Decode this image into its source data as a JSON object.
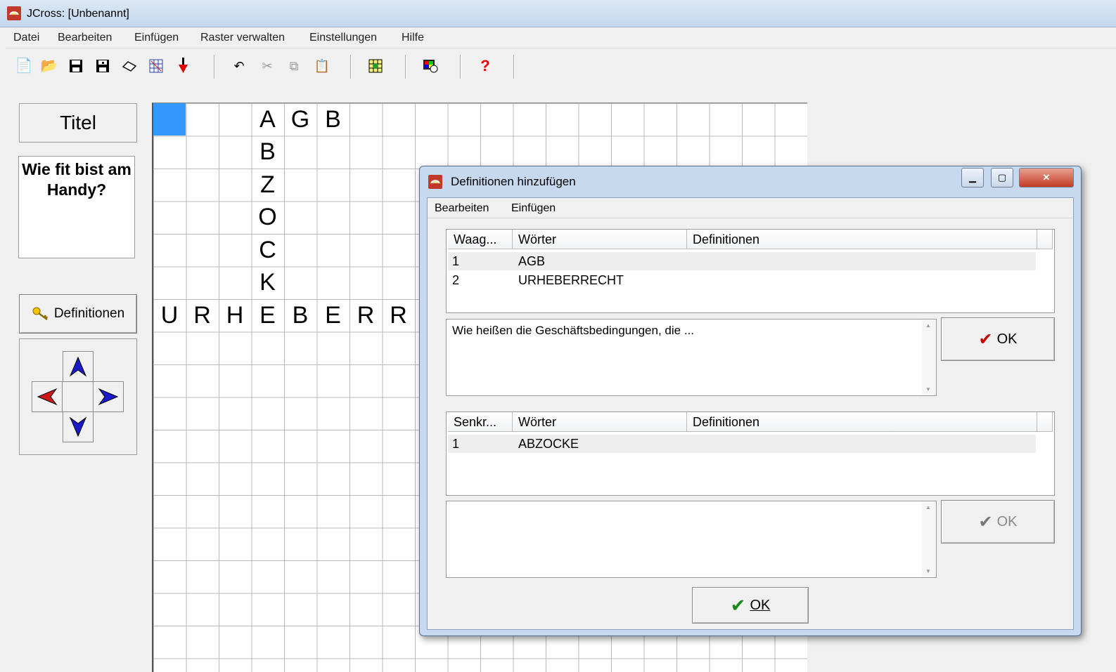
{
  "window": {
    "title": "JCross: [Unbenannt]"
  },
  "menu": [
    "Datei",
    "Bearbeiten",
    "Einfügen",
    "Raster verwalten",
    "Einstellungen",
    "Hilfe"
  ],
  "toolbar": {
    "icons": [
      "new-icon",
      "open-icon",
      "save-icon",
      "save-as-icon",
      "erase-icon",
      "grid-random-icon",
      "export-icon",
      "undo-icon",
      "cut-icon",
      "copy-icon",
      "paste-icon",
      "grid-add-icon",
      "web-icon",
      "help-icon"
    ]
  },
  "left": {
    "title_button": "Titel",
    "description": "Wie fit bist am Handy?",
    "definitions_button": "Definitionen"
  },
  "grid": {
    "cells": [
      {
        "r": 0,
        "c": 3,
        "ch": "A"
      },
      {
        "r": 0,
        "c": 4,
        "ch": "G"
      },
      {
        "r": 0,
        "c": 5,
        "ch": "B"
      },
      {
        "r": 1,
        "c": 3,
        "ch": "B"
      },
      {
        "r": 2,
        "c": 3,
        "ch": "Z"
      },
      {
        "r": 3,
        "c": 3,
        "ch": "O"
      },
      {
        "r": 4,
        "c": 3,
        "ch": "C"
      },
      {
        "r": 5,
        "c": 3,
        "ch": "K"
      },
      {
        "r": 6,
        "c": 0,
        "ch": "U"
      },
      {
        "r": 6,
        "c": 1,
        "ch": "R"
      },
      {
        "r": 6,
        "c": 2,
        "ch": "H"
      },
      {
        "r": 6,
        "c": 3,
        "ch": "E"
      },
      {
        "r": 6,
        "c": 4,
        "ch": "B"
      },
      {
        "r": 6,
        "c": 5,
        "ch": "E"
      },
      {
        "r": 6,
        "c": 6,
        "ch": "R"
      },
      {
        "r": 6,
        "c": 7,
        "ch": "R"
      }
    ]
  },
  "dialog": {
    "title": "Definitionen hinzufügen",
    "menu": [
      "Bearbeiten",
      "Einfügen"
    ],
    "across": {
      "headers": [
        "Waag...",
        "Wörter",
        "Definitionen"
      ],
      "rows": [
        {
          "num": "1",
          "word": "AGB"
        },
        {
          "num": "2",
          "word": "URHEBERRECHT"
        }
      ],
      "definition_text": "Wie heißen die Geschäftsbedingungen, die ...",
      "ok_label": "OK"
    },
    "down": {
      "headers": [
        "Senkr...",
        "Wörter",
        "Definitionen"
      ],
      "rows": [
        {
          "num": "1",
          "word": "ABZOCKE"
        }
      ],
      "definition_text": "",
      "ok_label": "OK"
    },
    "main_ok_label": "OK"
  },
  "colors": {
    "accent": "#3399ff",
    "check": "#cc0000",
    "check_green": "#1a8a1a"
  }
}
